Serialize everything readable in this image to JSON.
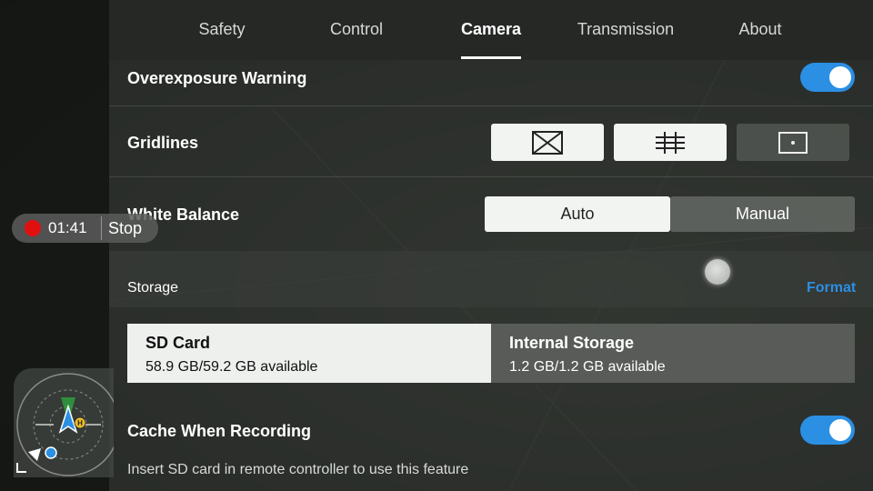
{
  "tabs": [
    {
      "label": "Safety"
    },
    {
      "label": "Control"
    },
    {
      "label": "Camera"
    },
    {
      "label": "Transmission"
    },
    {
      "label": "About"
    }
  ],
  "active_tab": "Camera",
  "overexposure": {
    "label": "Overexposure Warning",
    "enabled": true
  },
  "gridlines": {
    "label": "Gridlines",
    "options": [
      {
        "icon": "grid-diagonal-icon",
        "selected": true
      },
      {
        "icon": "grid-3x3-icon",
        "selected": true
      },
      {
        "icon": "grid-center-point-icon",
        "selected": false
      }
    ]
  },
  "white_balance": {
    "label": "White Balance",
    "options": [
      "Auto",
      "Manual"
    ],
    "selected": "Auto"
  },
  "storage": {
    "label": "Storage",
    "format_label": "Format",
    "cards": [
      {
        "title": "SD Card",
        "subtitle": "58.9 GB/59.2 GB available",
        "selected": true
      },
      {
        "title": "Internal Storage",
        "subtitle": "1.2 GB/1.2 GB available",
        "selected": false
      }
    ]
  },
  "cache": {
    "label": "Cache When Recording",
    "enabled": true,
    "hint": "Insert SD card in remote controller to use this feature"
  },
  "recording": {
    "time": "01:41",
    "stop_label": "Stop"
  },
  "radar": {
    "home_marker": "H"
  },
  "colors": {
    "accent": "#2b8fe3",
    "record": "#e01010"
  }
}
